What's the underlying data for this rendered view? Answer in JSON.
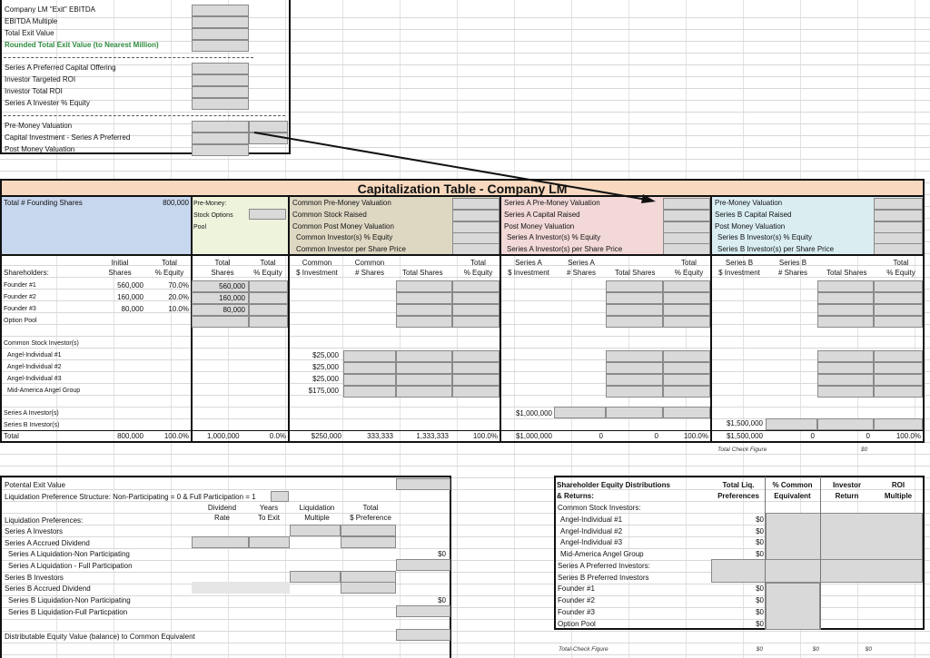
{
  "exit_section": {
    "company_exit_ebitda": "Company LM \"Exit\" EBITDA",
    "ebitda_multiple": "EBITDA Multiple",
    "total_exit_value": "Total Exit Value",
    "rounded_total": "Rounded Total Exit Value (to Nearest Million)",
    "series_a_offering": "Series A Preferred Capital Offering",
    "investor_targeted_roi": "Investor Targeted ROI",
    "investor_total_roi": "Investor Total ROI",
    "series_a_investor_equity": "Series A Invester % Equity",
    "pre_money": "Pre-Money Valuation",
    "capital_investment": "Capital Investment - Series A Preferred",
    "post_money": "Post Money Valuation"
  },
  "cap_table": {
    "title": "Capitalization Table - Company LM",
    "founding_label": "Total # Founding Shares",
    "founding_value": "800,000",
    "pool_label": [
      "Pre-Money:",
      "Stock Options",
      "Pool"
    ],
    "common_labels": [
      "Common Pre-Money Valuation",
      "Common Stock Raised",
      "Common Post Money Valuation",
      "Common Investor(s) % Equity",
      "Common Investor per Share Price"
    ],
    "series_a_labels": [
      "Series A Pre-Money Valuation",
      "Series A Capital Raised",
      "Post Money Valuation",
      "Series A Investor(s) % Equity",
      "Series A Investor(s) per Share Price"
    ],
    "series_b_labels": [
      "Pre-Money Valuation",
      "Series B Capital Raised",
      "Post Money Valuation",
      "Series B Investor(s) % Equity",
      "Series B Investor(s) per Share Price"
    ],
    "col_headers": {
      "shareholders": "Shareholders:",
      "initial": [
        "Initial",
        "Shares"
      ],
      "total_pct1": [
        "Total",
        "% Equity"
      ],
      "total_shares1": [
        "Total",
        "Shares"
      ],
      "total_pct2": [
        "Total",
        "% Equity"
      ],
      "common_inv": [
        "Common",
        "$ Investment"
      ],
      "common_shares": [
        "Common",
        "# Shares"
      ],
      "total_shares_c": "Total Shares",
      "total_pct_c": [
        "Total",
        "% Equity"
      ],
      "sa_inv": [
        "Series A",
        "$ Investment"
      ],
      "sa_shares": [
        "Series A",
        "# Shares"
      ],
      "total_shares_a": "Total Shares",
      "total_pct_a": [
        "Total",
        "% Equity"
      ],
      "sb_inv": [
        "Series B",
        "$ Investment"
      ],
      "sb_shares": [
        "Series B",
        "# Shares"
      ],
      "total_shares_b": "Total Shares",
      "total_pct_b": [
        "Total",
        "% Equity"
      ]
    },
    "founders": [
      {
        "name": "Founder #1",
        "initial": "560,000",
        "pct": "70.0%",
        "total": "560,000"
      },
      {
        "name": "Founder #2",
        "initial": "160,000",
        "pct": "20.0%",
        "total": "160,000"
      },
      {
        "name": "Founder #3",
        "initial": "80,000",
        "pct": "10.0%",
        "total": "80,000"
      },
      {
        "name": "Option Pool",
        "initial": "",
        "pct": "",
        "total": ""
      }
    ],
    "common_stock_investors": "Common Stock Investor(s)",
    "angels": [
      {
        "name": "Angel-Individual #1",
        "inv": "$25,000"
      },
      {
        "name": "Angel-Individual #2",
        "inv": "$25,000"
      },
      {
        "name": "Angel-Individual #3",
        "inv": "$25,000"
      },
      {
        "name": "Mid-America Angel Group",
        "inv": "$175,000"
      }
    ],
    "series_a_investors": "Series A Investor(s)",
    "series_b_investors": "Series B Investor(s)",
    "series_a_amount": "$1,000,000",
    "series_b_amount": "$1,500,000",
    "totals": {
      "label": "Total",
      "initial": "800,000",
      "pct1": "100.0%",
      "shares1": "1,000,000",
      "pct2": "0.0%",
      "common_inv": "$250,000",
      "common_shares": "333,333",
      "total_shares_c": "1,333,333",
      "pct_c": "100.0%",
      "sa_inv": "$1,000,000",
      "sa_shares": "0",
      "total_shares_a": "0",
      "pct_a": "100.0%",
      "sb_inv": "$1,500,000",
      "sb_shares": "0",
      "total_shares_b": "0",
      "pct_b": "100.0%"
    },
    "total_check_label": "Total Check Figure",
    "total_check_value": "$0"
  },
  "liquidation": {
    "potential_exit": "Potental Exit Value",
    "structure": "Liquidation Preference Structure:  Non-Participating = 0 & Full Participation = 1",
    "col_dividend": [
      "Dividend",
      "Rate"
    ],
    "col_years": [
      "Years",
      "To Exit"
    ],
    "col_multiple": [
      "Liquidation",
      "Multiple"
    ],
    "col_total": [
      "Total",
      "$ Preference"
    ],
    "rows": [
      "Liquidation Preferences:",
      "Series A Investors",
      "Series A Accrued Dividend",
      "Series A Liquidation-Non Participating",
      "Series A Liquidation - Full Participation",
      "Series B Investors",
      "Series B Accrued Dividend",
      "Series B Liquidation-Non Participating",
      "Series B Liquidation-Full Particpation"
    ],
    "series_a_total": "$0",
    "series_b_total": "$0",
    "distributable": "Distributable Equity Value (balance) to Common Equivalent"
  },
  "distributions": {
    "title": [
      "Shareholder Equity Distributions",
      "& Returns:"
    ],
    "col_liq": [
      "Total Liq.",
      "Preferences"
    ],
    "col_common": [
      "% Common",
      "Equivalent"
    ],
    "col_investor": [
      "Investor",
      "Return"
    ],
    "col_roi": [
      "ROI",
      "Multiple"
    ],
    "common_label": "Common Stock Investors:",
    "rows": [
      {
        "name": "Angel-Individual #1",
        "liq": "$0"
      },
      {
        "name": "Angel-Individual #2",
        "liq": "$0"
      },
      {
        "name": "Angel-Individual #3",
        "liq": "$0"
      },
      {
        "name": "Mid-America Angel Group",
        "liq": "$0"
      },
      {
        "name": "Series A Preferred Investors:",
        "liq": ""
      },
      {
        "name": "Series B Preferred Investors",
        "liq": ""
      },
      {
        "name": "Founder #1",
        "liq": "$0"
      },
      {
        "name": "Founder #2",
        "liq": "$0"
      },
      {
        "name": "Founder #3",
        "liq": "$0"
      },
      {
        "name": "Option Pool",
        "liq": "$0"
      }
    ],
    "check_label": "Total-Check Figure",
    "check_values": [
      "$0",
      "$0",
      "$0"
    ]
  }
}
